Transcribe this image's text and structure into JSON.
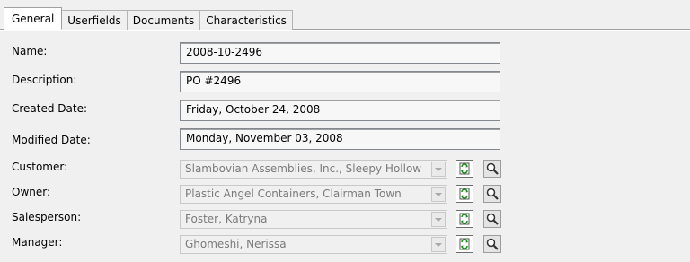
{
  "tabs": [
    {
      "label": "General"
    },
    {
      "label": "Userfields"
    },
    {
      "label": "Documents"
    },
    {
      "label": "Characteristics"
    }
  ],
  "fields": {
    "name": {
      "label": "Name:",
      "value": "2008-10-2496"
    },
    "description": {
      "label": "Description:",
      "value": "PO #2496"
    },
    "created": {
      "label": "Created Date:",
      "value": "Friday, October 24, 2008"
    },
    "modified": {
      "label": "Modified Date:",
      "value": "Monday, November 03, 2008"
    }
  },
  "lookups": {
    "customer": {
      "label": "Customer:",
      "value": "Slambovian Assemblies, Inc., Sleepy Hollow"
    },
    "owner": {
      "label": "Owner:",
      "value": "Plastic Angel Containers, Clairman Town"
    },
    "salesperson": {
      "label": "Salesperson:",
      "value": "Foster, Katryna"
    },
    "manager": {
      "label": "Manager:",
      "value": "Ghomeshi, Nerissa"
    }
  },
  "icons": {
    "refresh": "refresh-icon",
    "search": "magnifier-icon"
  }
}
